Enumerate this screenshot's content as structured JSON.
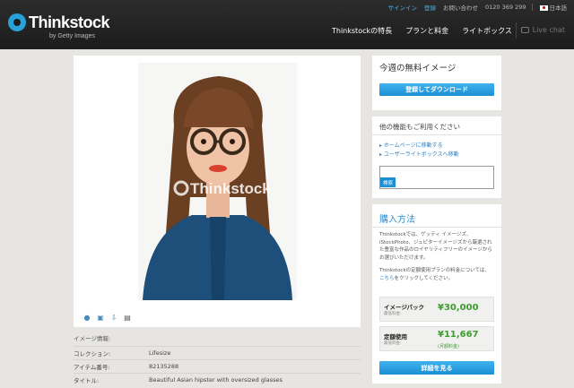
{
  "header": {
    "logo": "Thinkstock",
    "logo_sub": "by Getty Images",
    "util": {
      "signin": "サインイン",
      "register": "登録",
      "help": "お問い合わせ",
      "phone": "0120 369 299",
      "language": "日本語"
    },
    "nav": [
      "Thinkstockの特長",
      "プランと料金",
      "ライトボックス"
    ],
    "live_chat": "Live chat"
  },
  "main": {
    "watermark": "Thinkstock",
    "tools": [
      "light-bulb-icon",
      "zoom-icon",
      "download-icon",
      "print-icon"
    ]
  },
  "info": {
    "title": "イメージ情報:",
    "rows": [
      {
        "key": "コレクション:",
        "value": "Lifesize"
      },
      {
        "key": "アイテム番号:",
        "value": "82135288"
      },
      {
        "key": "タイトル:",
        "value": "Beautiful Asian hipster with oversized glasses"
      }
    ]
  },
  "sidebar": {
    "free_image": {
      "title": "今週の無料イメージ",
      "button": "登録してダウンロード"
    },
    "other": {
      "title": "他の機能もご利用ください",
      "links": [
        "ホームページに移動する",
        "ユーザーライトボックスへ移動"
      ],
      "search_button": "検索"
    },
    "purchase": {
      "title": "購入方法",
      "para1": "Thinkstockでは、ゲッティ イメージズ、iStockPhoto、ジュピターイメージズから厳選された豊富な作品のロイヤリティフリーのイメージからお選びいただけます。",
      "para2_pre": "Thinkstockの定額使用プランの料金については、",
      "para2_link": "こちら",
      "para2_post": "をクリックしてください。",
      "packs": [
        {
          "label": "イメージパック",
          "sub": "最低料金:",
          "price": "¥30,000",
          "note": ""
        },
        {
          "label": "定額使用",
          "sub": "最低料金:",
          "price": "¥11,667",
          "note": "(月額料金)"
        }
      ],
      "button": "詳細を見る"
    }
  },
  "colors": {
    "accent": "#1a8fd4",
    "price_green": "#3c9d2e",
    "header_bg": "#222222"
  }
}
